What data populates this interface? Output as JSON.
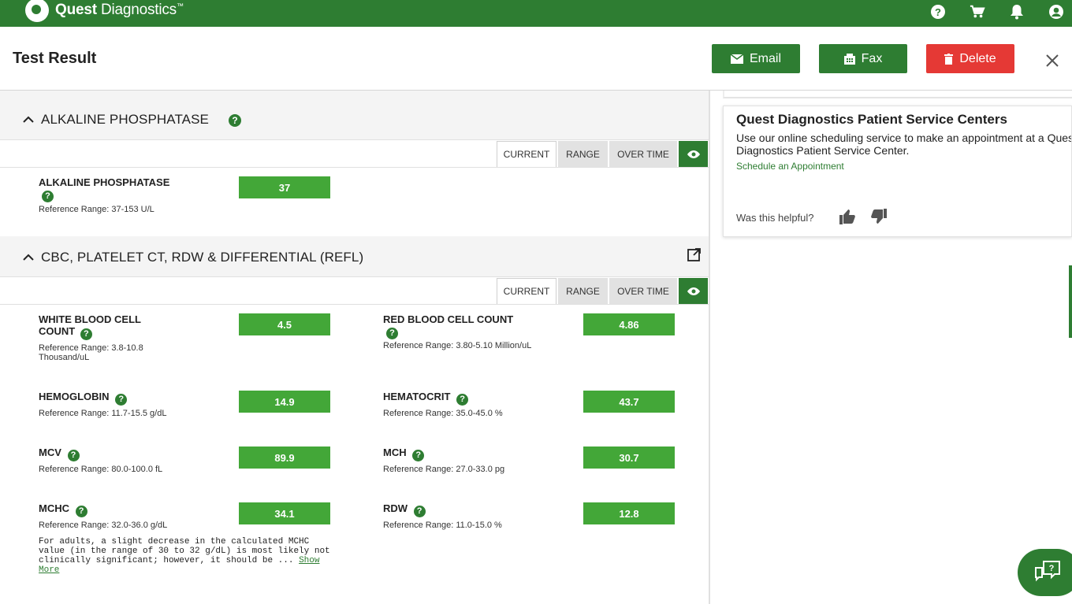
{
  "brand": {
    "name_bold": "Quest",
    "name_rest": " Diagnostics",
    "trademark": "™"
  },
  "top_icons": [
    "help-icon",
    "cart-icon",
    "bell-icon",
    "account-icon"
  ],
  "header": {
    "title": "Test Result",
    "email_label": "Email",
    "fax_label": "Fax",
    "delete_label": "Delete"
  },
  "tabs": {
    "current": "CURRENT",
    "range": "RANGE",
    "over_time": "OVER TIME"
  },
  "sections": [
    {
      "title": "ALKALINE PHOSPHATASE",
      "tests": [
        {
          "name": "ALKALINE PHOSPHATASE",
          "ref": "Reference Range: 37-153 U/L",
          "value": "37"
        }
      ]
    },
    {
      "title": "CBC, PLATELET CT, RDW & DIFFERENTIAL (REFL)",
      "tests": [
        {
          "name_line1": "WHITE BLOOD CELL",
          "name_line2": "COUNT",
          "ref_line1": "Reference Range: 3.8-10.8",
          "ref_line2": "Thousand/uL",
          "value": "4.5"
        },
        {
          "name": "RED BLOOD CELL COUNT",
          "ref": "Reference Range: 3.80-5.10 Million/uL",
          "value": "4.86"
        },
        {
          "name": "HEMOGLOBIN",
          "ref": "Reference Range: 11.7-15.5 g/dL",
          "value": "14.9"
        },
        {
          "name": "HEMATOCRIT",
          "ref": "Reference Range: 35.0-45.0 %",
          "value": "43.7"
        },
        {
          "name": "MCV",
          "ref": "Reference Range: 80.0-100.0 fL",
          "value": "89.9"
        },
        {
          "name": "MCH",
          "ref": "Reference Range: 27.0-33.0 pg",
          "value": "30.7"
        },
        {
          "name": "MCHC",
          "ref": "Reference Range: 32.0-36.0 g/dL",
          "value": "34.1"
        },
        {
          "name": "RDW",
          "ref": "Reference Range: 11.0-15.0 %",
          "value": "12.8"
        }
      ],
      "note": {
        "text": "For adults, a slight decrease in the calculated MCHC value (in the range of 30 to 32 g/dL) is most likely not clinically significant; however, it should be ...",
        "show_more": "Show More"
      }
    }
  ],
  "side_card": {
    "title": "Quest Diagnostics Patient Service Centers",
    "desc": "Use our online scheduling service to make an appointment at a Quest Diagnostics Patient Service Center.",
    "link": "Schedule an Appointment",
    "helpful": "Was this helpful?"
  },
  "colors": {
    "brand_green": "#2e7d32",
    "value_green": "#43a738",
    "delete_red": "#e53935"
  }
}
